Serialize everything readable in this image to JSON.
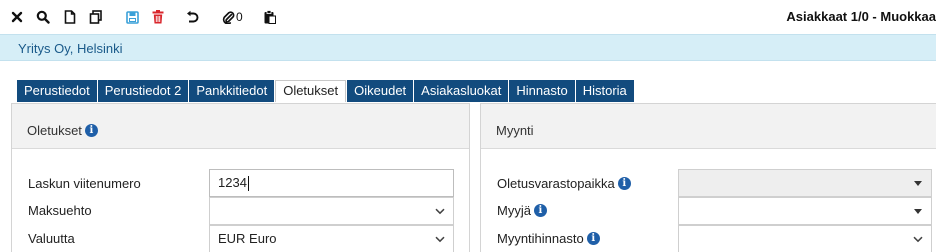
{
  "toolbar": {
    "icons": [
      "close-icon",
      "search-icon",
      "new-document-icon",
      "copy-icon",
      "save-icon",
      "delete-icon",
      "undo-icon",
      "attachment-icon",
      "clipboard-icon"
    ],
    "attachment_count": "0",
    "window_title": "Asiakkaat 1/0 - Muokkaa"
  },
  "company": {
    "name": "Yritys Oy, Helsinki"
  },
  "tabs": [
    {
      "label": "Perustiedot",
      "active": false
    },
    {
      "label": "Perustiedot 2",
      "active": false
    },
    {
      "label": "Pankkitiedot",
      "active": false
    },
    {
      "label": "Oletukset",
      "active": true
    },
    {
      "label": "Oikeudet",
      "active": false
    },
    {
      "label": "Asiakasluokat",
      "active": false
    },
    {
      "label": "Hinnasto",
      "active": false
    },
    {
      "label": "Historia",
      "active": false
    }
  ],
  "left_panel": {
    "title": "Oletukset",
    "fields": {
      "invoice_ref": {
        "label": "Laskun viitenumero",
        "value": "1234"
      },
      "payment_term": {
        "label": "Maksuehto",
        "value": ""
      },
      "currency": {
        "label": "Valuutta",
        "value": "EUR Euro"
      }
    }
  },
  "right_panel": {
    "title": "Myynti",
    "fields": {
      "default_warehouse": {
        "label": "Oletusvarastopaikka",
        "value": ""
      },
      "seller": {
        "label": "Myyjä",
        "value": ""
      },
      "sales_pricelist": {
        "label": "Myyntihinnasto",
        "value": ""
      }
    }
  },
  "colors": {
    "tab_bg": "#124b7e",
    "company_bar_bg": "#d6eef7",
    "info_icon": "#1f5fa8",
    "delete_icon": "#d9262c",
    "save_icon": "#3aa0d8"
  }
}
